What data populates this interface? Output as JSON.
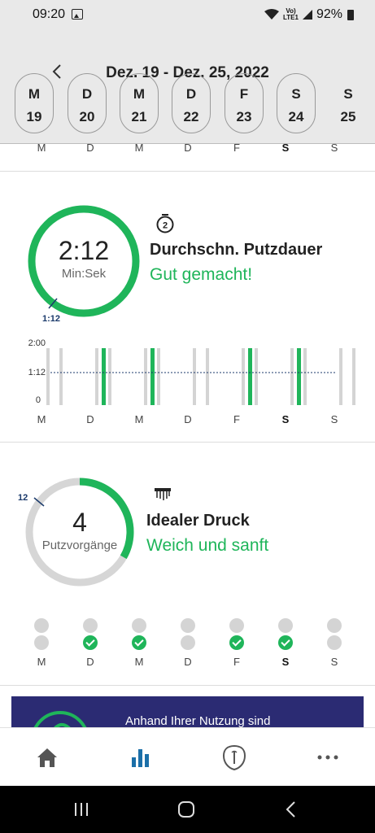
{
  "status_bar": {
    "time": "09:20",
    "volte_top": "Vo)",
    "volte_bottom": "LTE1",
    "battery": "92%"
  },
  "week": {
    "title": "Dez. 19 - Dez. 25, 2022",
    "days": [
      {
        "letter": "M",
        "date": "19"
      },
      {
        "letter": "D",
        "date": "20"
      },
      {
        "letter": "M",
        "date": "21"
      },
      {
        "letter": "D",
        "date": "22"
      },
      {
        "letter": "F",
        "date": "23"
      },
      {
        "letter": "S",
        "date": "24"
      },
      {
        "letter": "S",
        "date": "25"
      }
    ]
  },
  "weekday_labels": [
    "M",
    "D",
    "M",
    "D",
    "F",
    "S",
    "S"
  ],
  "duration_card": {
    "value": "2:12",
    "unit": "Min:Sek",
    "target_marker": "1:12",
    "title": "Durchschn. Putzdauer",
    "status": "Gut gemacht!",
    "progress": 1.0,
    "icon": "stopwatch-2-icon",
    "chart_data": {
      "type": "bar",
      "categories": [
        "M",
        "D",
        "M",
        "D",
        "F",
        "S",
        "S"
      ],
      "y_ticks": [
        "2:00",
        "1:12",
        "0"
      ],
      "active_days": [
        false,
        true,
        true,
        false,
        true,
        true,
        false
      ],
      "target_line": "1:12"
    }
  },
  "pressure_card": {
    "value": "4",
    "unit": "Putzvorgänge",
    "target_marker": "12",
    "title": "Idealer Druck",
    "status": "Weich und sanft",
    "progress": 0.333,
    "icon": "brush-head-icon",
    "dots_top": [
      false,
      false,
      false,
      false,
      false,
      false,
      false
    ],
    "dots_bottom": [
      false,
      true,
      true,
      false,
      true,
      true,
      false
    ]
  },
  "promo": {
    "text": "Anhand Ihrer Nutzung sind"
  },
  "nav": {
    "items": [
      "home-icon",
      "stats-icon",
      "philips-shield-icon",
      "more-icon"
    ]
  },
  "colors": {
    "accent_green": "#1fb55a",
    "gray_ring": "#d6d6d6",
    "navy": "#1b3a6b",
    "active_nav": "#1b6fa8"
  }
}
